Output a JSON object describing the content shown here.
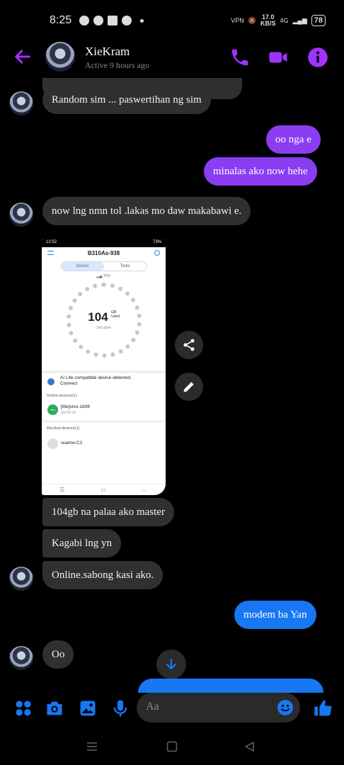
{
  "status_bar": {
    "time": "8:25",
    "net_speed_value": "17.0",
    "net_speed_unit": "KB/S",
    "net_type": "4G",
    "battery": "78",
    "vpn": "VPN"
  },
  "header": {
    "contact_name": "XieKram",
    "active_status": "Active 9 hours ago"
  },
  "colors": {
    "accent_purple": "#8b3df2",
    "header_icon_purple": "#a033ff",
    "accent_blue": "#1877f2",
    "incoming_bubble": "#303030"
  },
  "messages": [
    {
      "side": "in",
      "text": "Random sim ... paswertihan ng sim"
    },
    {
      "side": "out",
      "text": "oo nga e"
    },
    {
      "side": "out",
      "text": "minalas ako now hehe"
    },
    {
      "side": "in",
      "text": "now lng nmn tol .lakas mo daw makabawi e."
    },
    {
      "side": "in",
      "text": "104gb na palaa ako master"
    },
    {
      "side": "in",
      "text": "Kagabi  lng yn"
    },
    {
      "side": "in",
      "text": "Online.sabong kasi ako."
    },
    {
      "side": "out",
      "text": "modem ba Yan"
    },
    {
      "side": "in",
      "text": "Oo"
    }
  ],
  "shared_image": {
    "status_time": "12:52",
    "status_battery": "73%",
    "title": "B310As-938",
    "tabs": [
      "Device",
      "Tools"
    ],
    "network": "TNT",
    "usage_value": "104",
    "usage_unit_top": "GB",
    "usage_unit_bottom": "Used",
    "usage_sub": "Set plan",
    "ai_notice_line1": "AI Life compatible device detected.",
    "ai_notice_line2": "Connect",
    "online_header": "Online devices(1)",
    "online_device_name": "[Me]vivo-1808",
    "online_device_time": "00:00:15",
    "online_device_badge": "vivo",
    "blocked_header": "Blocked devices(1)",
    "blocked_device_name": "realme-C2"
  },
  "composer": {
    "placeholder": "Aa"
  },
  "icons": {
    "back": "arrow-left-icon",
    "call": "phone-icon",
    "video": "video-camera-icon",
    "info": "info-icon",
    "share": "share-icon",
    "edit": "pencil-icon",
    "scroll_down": "arrow-down-icon",
    "menu": "four-dots-icon",
    "camera": "camera-icon",
    "gallery": "image-icon",
    "mic": "microphone-icon",
    "emoji": "smiley-icon",
    "like": "thumbs-up-icon"
  }
}
